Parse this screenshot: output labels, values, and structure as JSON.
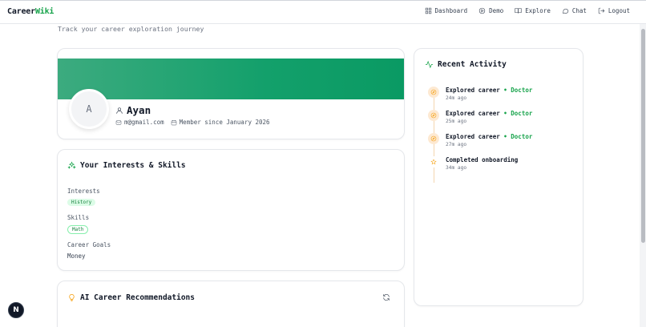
{
  "brand": {
    "part1": "Career",
    "part2": "Wiki"
  },
  "nav": {
    "items": [
      {
        "label": "Dashboard",
        "icon": "grid-icon"
      },
      {
        "label": "Demo",
        "icon": "play-circle-icon"
      },
      {
        "label": "Explore",
        "icon": "book-icon"
      },
      {
        "label": "Chat",
        "icon": "chat-bubble-icon"
      },
      {
        "label": "Logout",
        "icon": "logout-icon"
      }
    ]
  },
  "page": {
    "subtitle": "Track your career exploration journey"
  },
  "profile": {
    "avatar_initial": "A",
    "name": "Ayan",
    "email": "m@gmail.com",
    "member_since": "Member since January 2026"
  },
  "interests_card": {
    "title": "Your Interests & Skills",
    "interests_label": "Interests",
    "interests": [
      "History"
    ],
    "skills_label": "Skills",
    "skills": [
      "Math"
    ],
    "goals_label": "Career Goals",
    "goals_value": "Money"
  },
  "ai_card": {
    "title": "AI Career Recommendations"
  },
  "activity": {
    "title": "Recent Activity",
    "items": [
      {
        "text": "Explored career",
        "target": "Doctor",
        "time": "24m ago",
        "icon": "compass-icon"
      },
      {
        "text": "Explored career",
        "target": "Doctor",
        "time": "25m ago",
        "icon": "compass-icon"
      },
      {
        "text": "Explored career",
        "target": "Doctor",
        "time": "27m ago",
        "icon": "compass-icon"
      },
      {
        "text": "Completed onboarding",
        "target": "",
        "time": "34m ago",
        "icon": "star-icon"
      }
    ]
  },
  "floating": {
    "label": "N"
  },
  "colors": {
    "accent": "#16a34a",
    "banner_start": "#3cab7f",
    "banner_end": "#0a9a63",
    "activity_icon": "#f59e0b"
  }
}
